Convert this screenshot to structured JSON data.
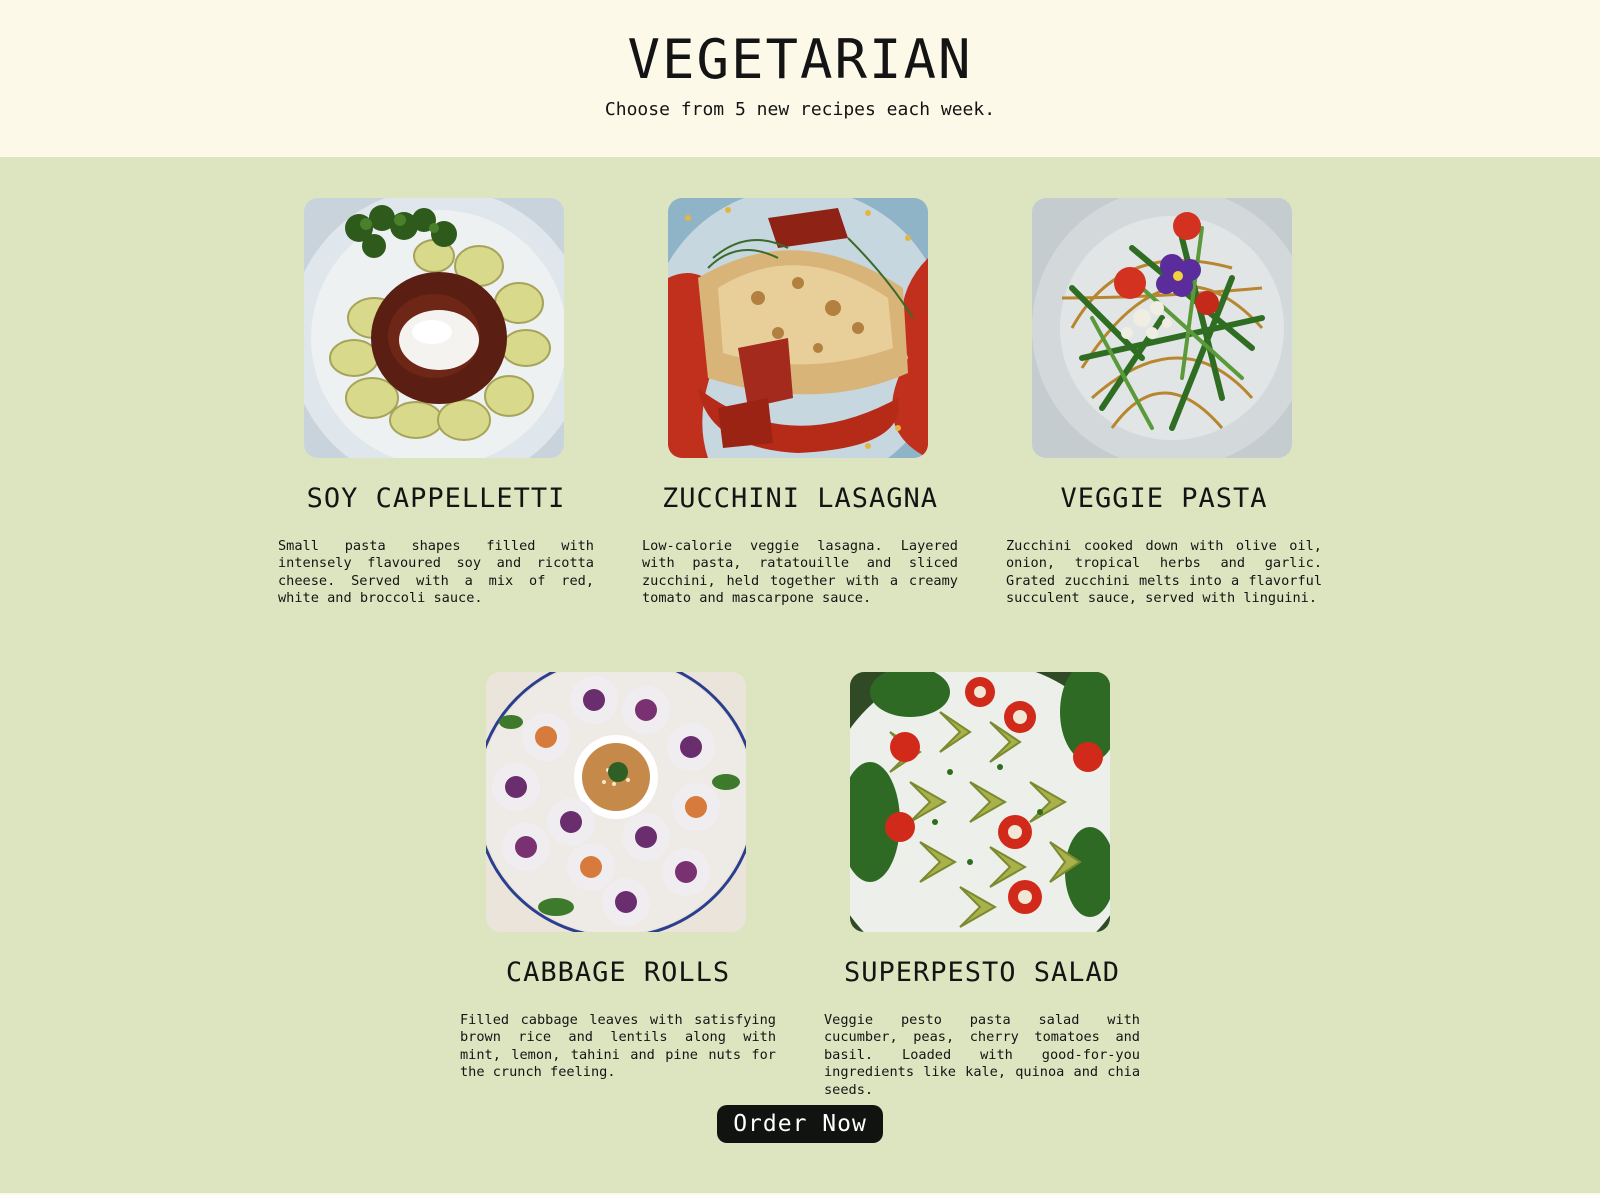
{
  "header": {
    "title": "VEGETARIAN",
    "subtitle": "Choose from 5 new recipes each week."
  },
  "recipes": [
    {
      "title": "SOY CAPPELLETTI",
      "description": "Small pasta shapes filled with intensely flavoured soy and ricotta cheese. Served with a mix of red, white and broccoli sauce."
    },
    {
      "title": "ZUCCHINI LASAGNA",
      "description": "Low-calorie veggie lasagna. Layered with pasta, ratatouille and sliced zucchini, held together with a creamy tomato and mascarpone sauce."
    },
    {
      "title": "VEGGIE PASTA",
      "description": "Zucchini cooked down with olive oil, onion, tropical herbs and garlic. Grated zucchini melts into a flavorful succulent sauce, served with linguini."
    },
    {
      "title": "CABBAGE ROLLS",
      "description": "Filled cabbage leaves with satisfying brown rice and lentils along with mint, lemon, tahini and pine nuts for the crunch feeling."
    },
    {
      "title": "SUPERPESTO SALAD",
      "description": "Veggie pesto pasta salad with cucumber, peas, cherry tomatoes and basil. Loaded with good-for-you ingredients like kale, quinoa and chia seeds."
    }
  ],
  "order_button": {
    "label": "Order Now"
  },
  "colors": {
    "header_bg": "#fdf9e9",
    "main_bg": "#dde5c0",
    "button_bg": "#111311",
    "text": "#141414"
  }
}
